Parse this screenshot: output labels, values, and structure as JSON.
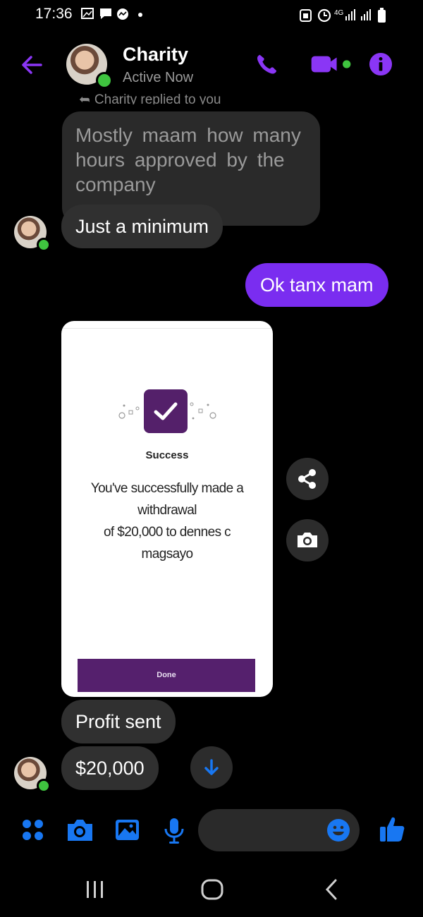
{
  "status_bar": {
    "time": "17:36",
    "network": "4G"
  },
  "header": {
    "name": "Charity",
    "presence": "Active Now"
  },
  "colors": {
    "accent": "#7a2df0",
    "link_blue": "#1877f2",
    "online": "#3fc43f"
  },
  "messages": {
    "replied_note": "Charity replied to you",
    "quoted": "Mostly  maam how many hours   approved  by the company",
    "m1": "Just a minimum",
    "m2": "Ok tanx mam",
    "image": {
      "title": "Success",
      "line1": "You've successfully made a",
      "line2": "withdrawal",
      "line3": "of $20,000 to dennes c",
      "line4": "magsayo",
      "button": "Done"
    },
    "m3": "Profit sent",
    "m4": "$20,000"
  },
  "icons": {
    "header": [
      "back-arrow-icon",
      "phone-icon",
      "video-icon",
      "info-icon"
    ],
    "composer": [
      "menu-dots-icon",
      "camera-icon",
      "gallery-icon",
      "mic-icon",
      "emoji-icon",
      "thumbs-up-icon"
    ],
    "side": [
      "share-icon",
      "camera-icon"
    ],
    "nav": [
      "recents-icon",
      "home-icon",
      "back-icon"
    ]
  }
}
